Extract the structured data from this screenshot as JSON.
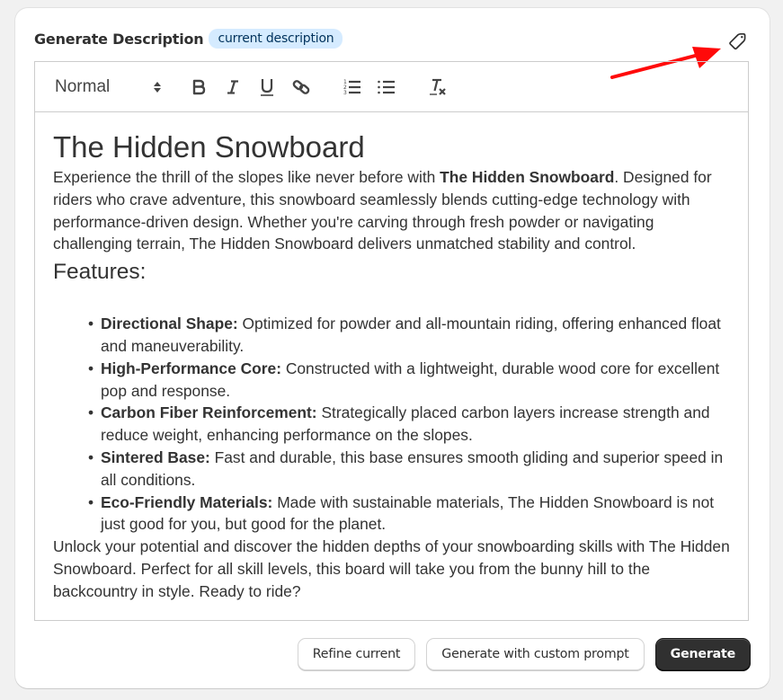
{
  "header": {
    "title": "Generate Description",
    "badge": "current description",
    "tag_icon": "tag-icon"
  },
  "annotation": {
    "arrow_color": "#ff0000",
    "arrow_icon": "red-arrow-pointing-to-tag-icon"
  },
  "toolbar": {
    "format_select": "Normal",
    "buttons": [
      "bold",
      "italic",
      "underline",
      "link",
      "ordered-list",
      "bullet-list",
      "clear-formatting"
    ]
  },
  "content": {
    "heading": "The Hidden Snowboard",
    "intro_pre": "Experience the thrill of the slopes like never before with ",
    "intro_bold": "The Hidden Snowboard",
    "intro_post": ". Designed for riders who crave adventure, this snowboard seamlessly blends cutting-edge technology with performance-driven design. Whether you're carving through fresh powder or navigating challenging terrain, The Hidden Snowboard delivers unmatched stability and control.",
    "features_heading": "Features:",
    "features": [
      {
        "label": "Directional Shape:",
        "text": " Optimized for powder and all-mountain riding, offering enhanced float and maneuverability."
      },
      {
        "label": "High-Performance Core:",
        "text": " Constructed with a lightweight, durable wood core for excellent pop and response."
      },
      {
        "label": "Carbon Fiber Reinforcement:",
        "text": " Strategically placed carbon layers increase strength and reduce weight, enhancing performance on the slopes."
      },
      {
        "label": "Sintered Base:",
        "text": " Fast and durable, this base ensures smooth gliding and superior speed in all conditions."
      },
      {
        "label": "Eco-Friendly Materials:",
        "text": " Made with sustainable materials, The Hidden Snowboard is not just good for you, but good for the planet."
      }
    ],
    "outro": "Unlock your potential and discover the hidden depths of your snowboarding skills with The Hidden Snowboard. Perfect for all skill levels, this board will take you from the bunny hill to the backcountry in style. Ready to ride?"
  },
  "footer": {
    "refine_label": "Refine current",
    "custom_prompt_label": "Generate with custom prompt",
    "generate_label": "Generate"
  }
}
